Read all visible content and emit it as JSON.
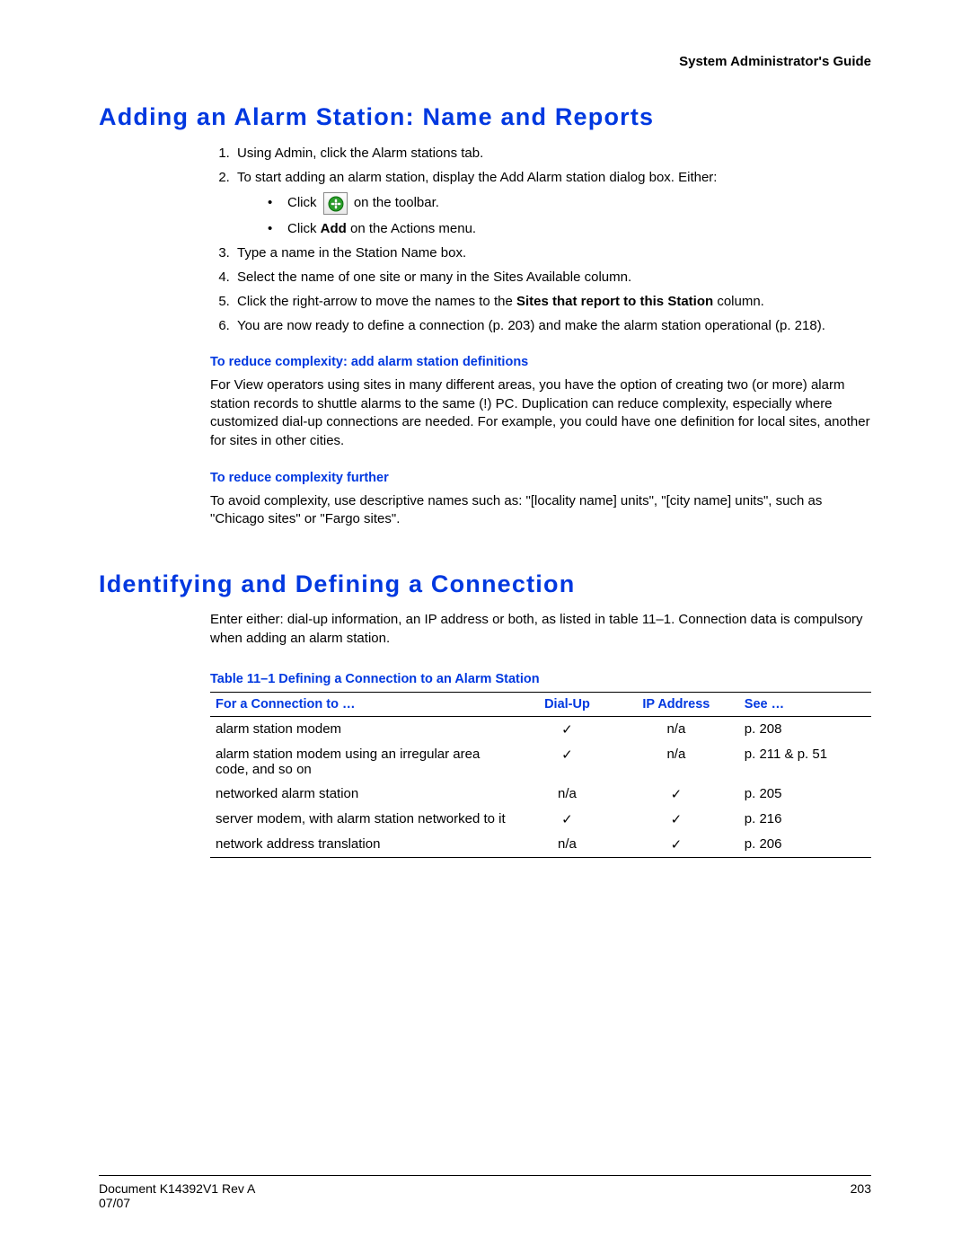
{
  "header": {
    "guide": "System Administrator's Guide"
  },
  "section1": {
    "title": "Adding an Alarm Station: Name and Reports",
    "steps": [
      "Using Admin, click the Alarm stations tab.",
      "To start adding an alarm station, display the Add Alarm station dialog box. Either:",
      "Type a name in the Station Name box.",
      "Select the name of one site or many in the Sites Available column.",
      "",
      "You are now ready to define a connection (p. 203) and make the alarm station operational (p. 218)."
    ],
    "step5_pre": "Click the right-arrow to move the names to the ",
    "step5_bold": "Sites that report to this Station",
    "step5_post": " column.",
    "sub_click": "Click ",
    "sub_click_post": " on the toolbar.",
    "sub_add_pre": "Click ",
    "sub_add_bold": "Add",
    "sub_add_post": " on the Actions menu.",
    "reduce1_heading": "To reduce complexity: add alarm station definitions",
    "reduce1_body": "For View operators using sites in many different areas, you have the option of creating two (or more) alarm station records to shuttle alarms to the same (!) PC. Duplication can reduce complexity, especially where customized dial-up connections are needed. For example, you could have one definition for local sites, another for sites in other cities.",
    "reduce2_heading": "To reduce complexity further",
    "reduce2_body": "To avoid complexity, use descriptive names such as: \"[locality name] units\", \"[city name] units\", such as \"Chicago sites\" or \"Fargo sites\"."
  },
  "section2": {
    "title": "Identifying and Defining a Connection",
    "intro": "Enter either: dial-up information, an IP address or both, as listed in table 11–1. Connection data is compulsory when adding an alarm station.",
    "table_caption": "Table 11–1  Defining a Connection to an Alarm Station",
    "headers": {
      "c1": "For a Connection to …",
      "c2": "Dial-Up",
      "c3": "IP Address",
      "c4": "See …"
    },
    "rows": [
      {
        "c1": "alarm station modem",
        "c2": "✓",
        "c3": "n/a",
        "c4": "p. 208"
      },
      {
        "c1": "alarm station modem using an irregular area code, and so on",
        "c2": "✓",
        "c3": "n/a",
        "c4": "p. 211 & p. 51"
      },
      {
        "c1": "networked alarm station",
        "c2": "n/a",
        "c3": "✓",
        "c4": "p. 205"
      },
      {
        "c1": "server modem, with alarm station networked to it",
        "c2": "✓",
        "c3": "✓",
        "c4": "p. 216"
      },
      {
        "c1": "network address translation",
        "c2": "n/a",
        "c3": "✓",
        "c4": "p. 206"
      }
    ]
  },
  "footer": {
    "doc": "Document K14392V1 Rev A",
    "date": "07/07",
    "page": "203"
  }
}
